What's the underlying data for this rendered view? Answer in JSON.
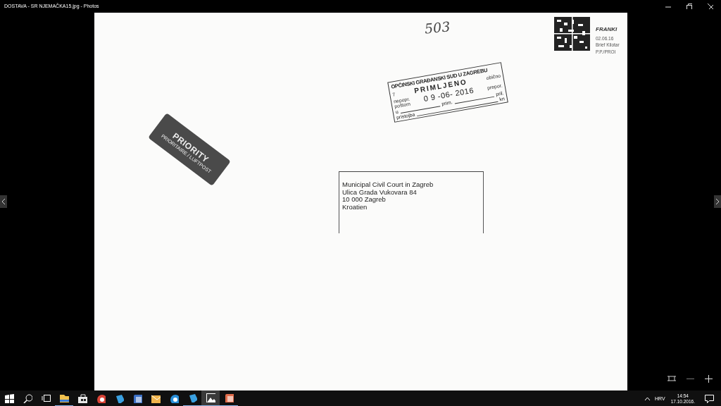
{
  "window": {
    "title": "DOSTAVA - SR NJEMAČKA15.jpg - Photos"
  },
  "document": {
    "handwritten_number": "503",
    "franking": {
      "lines": [
        "FRANKI",
        "02.06.16",
        "Brief Kilotar",
        "P.P./PROI"
      ]
    },
    "priority_label": {
      "title": "PRIORITY",
      "subtitle": "PRIORITAIRE / LUFTPOST"
    },
    "stamp": {
      "court": "OPĆINSKI GRAĐANSKI SUD U ZAGREBU",
      "number": "7",
      "heading": "PRIMLJENO",
      "left_top": "nepopr.",
      "left_bottom": "poštom",
      "date": "0 9 -06- 2016",
      "right_top": "obično",
      "right_bottom": "prepor.",
      "u": "u",
      "prim": "prim.",
      "pril": "pril.",
      "pristojba": "pristojba",
      "kn": "kn"
    },
    "address": [
      "Municipal Civil Court in Zagreb",
      "Ulica Grada Vukovara 84",
      "10 000 Zagreb",
      "Kroatien"
    ]
  },
  "taskbar": {
    "apps": [
      {
        "kind": "folder",
        "running": true,
        "selected": false
      },
      {
        "kind": "store",
        "running": false,
        "selected": false
      },
      {
        "kind": "chrome",
        "running": false,
        "selected": false
      },
      {
        "kind": "blue",
        "running": false,
        "selected": false
      },
      {
        "kind": "word",
        "running": false,
        "selected": false
      },
      {
        "kind": "mail",
        "running": false,
        "selected": false
      },
      {
        "kind": "edge",
        "running": false,
        "selected": false
      },
      {
        "kind": "blue",
        "running": true,
        "selected": false
      },
      {
        "kind": "photos",
        "running": true,
        "selected": true
      },
      {
        "kind": "office",
        "running": true,
        "selected": false
      }
    ],
    "tray": {
      "language": "HRV",
      "time": "14:54",
      "date": "17.10.2016."
    }
  }
}
